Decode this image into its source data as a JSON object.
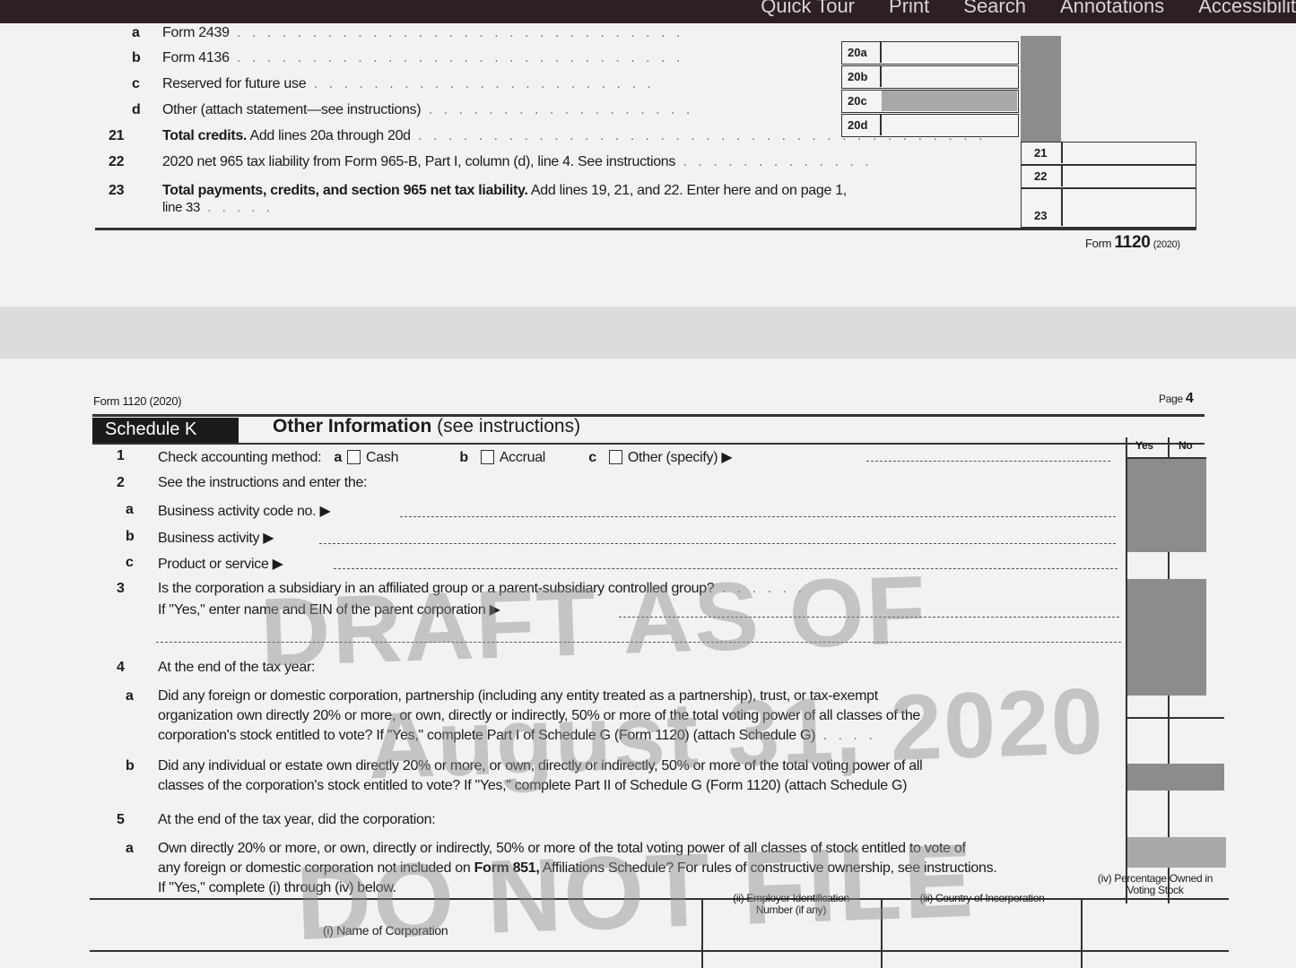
{
  "toolbar": {
    "quick_tour": "Quick Tour",
    "print": "Print",
    "search": "Search",
    "annotations": "Annotations",
    "accessibility": "Accessibilit"
  },
  "top_page": {
    "lines": [
      {
        "num": "a",
        "text": "Form 2439"
      },
      {
        "num": "b",
        "text": "Form 4136"
      },
      {
        "num": "c",
        "text": "Reserved for future use"
      },
      {
        "num": "d",
        "text": "Other (attach statement—see instructions)"
      },
      {
        "num": "21",
        "bold_text": "Total credits.",
        "text": " Add lines 20a through 20d"
      },
      {
        "num": "22",
        "text": "2020 net 965 tax liability from Form 965-B, Part I, column (d), line 4. See instructions"
      },
      {
        "num": "23",
        "bold_text": "Total payments, credits, and section 965 net tax liability.",
        "text": " Add lines 19, 21, and 22. Enter here and on page 1,",
        "text2": "line 33"
      }
    ],
    "box_labels": [
      "20a",
      "20b",
      "20c",
      "20d",
      "21",
      "22",
      "23"
    ],
    "footer_form": "Form",
    "footer_num": "1120",
    "footer_year": "(2020)"
  },
  "bottom_page": {
    "header_left": "Form 1120 (2020)",
    "header_right_prefix": "Page",
    "header_right_num": "4",
    "schedule_label": "Schedule K",
    "schedule_title": "Other Information",
    "schedule_title_suffix": " (see instructions)",
    "col_yes": "Yes",
    "col_no": "No",
    "q1_num": "1",
    "q1_text": "Check accounting method:",
    "q1_a": "a",
    "q1_cash": "Cash",
    "q1_b": "b",
    "q1_accrual": "Accrual",
    "q1_c": "c",
    "q1_other": "Other (specify) ▶",
    "q2_num": "2",
    "q2_text": "See the instructions and enter the:",
    "q2a_letter": "a",
    "q2a_text": "Business activity code no. ▶",
    "q2b_letter": "b",
    "q2b_text": "Business activity ▶",
    "q2c_letter": "c",
    "q2c_text": "Product or service ▶",
    "q3_num": "3",
    "q3_text": "Is the corporation a subsidiary in an affiliated group or a parent-subsidiary controlled group?",
    "q3_sub": "If \"Yes,\" enter name and EIN of the parent corporation ▶",
    "q4_num": "4",
    "q4_text": "At the end of the tax year:",
    "q4a_letter": "a",
    "q4a_l1": "Did any foreign or domestic corporation, partnership (including any entity treated as a partnership), trust, or tax-exempt",
    "q4a_l2": "organization own directly 20% or more, or own, directly or indirectly, 50% or more of the total voting power of all classes of the",
    "q4a_l3": "corporation's stock entitled to vote? If \"Yes,\" complete Part I of Schedule G (Form 1120) (attach Schedule G)",
    "q4b_letter": "b",
    "q4b_l1": "Did any individual or estate own directly 20% or more, or own, directly or indirectly, 50% or more of the total voting power of all",
    "q4b_l2": "classes of the corporation's stock entitled to vote? If \"Yes,\" complete Part II of Schedule G (Form 1120) (attach Schedule G)",
    "q5_num": "5",
    "q5_text": "At the end of the tax year, did the corporation:",
    "q5a_letter": "a",
    "q5a_l1": "Own directly 20% or more, or own, directly or indirectly, 50% or more of the total voting power of all classes of stock entitled to vote of",
    "q5a_l2_pre": "any foreign or domestic corporation not included on ",
    "q5a_l2_bold": "Form 851,",
    "q5a_l2_post": " Affiliations Schedule? For rules of constructive ownership, see instructions.",
    "q5a_l3": "If \"Yes,\" complete (i) through (iv) below.",
    "table_headers": [
      "(i) Name of Corporation",
      "(ii) Employer Identification Number (if any)",
      "(iii) Country of Incorporation",
      "(iv) Percentage Owned in Voting Stock"
    ],
    "watermark_1": "DRAFT AS OF",
    "watermark_2": "August 31, 2020",
    "watermark_3": "DO NOT FILE"
  }
}
